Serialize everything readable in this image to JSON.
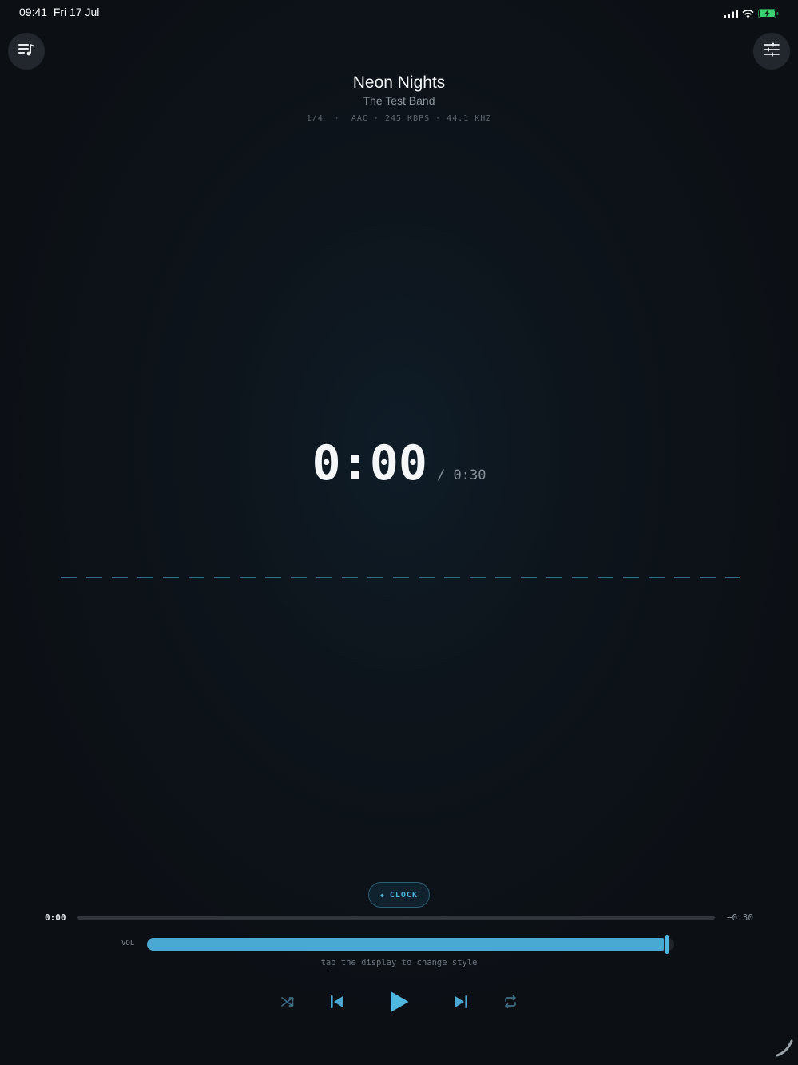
{
  "status_bar": {
    "time_date": "09:41  Fri 17 Jul",
    "icons": [
      "cellular-signal-icon",
      "wifi-icon",
      "battery-charging-icon"
    ],
    "battery_color": "#3bd16f"
  },
  "header": {
    "left_button_icon": "playlist-icon",
    "right_button_icon": "equalizer-sliders-icon"
  },
  "track": {
    "title": "Neon Nights",
    "artist": "The Test Band",
    "meta": "1/4  ·  AAC · 245 KBPS · 44.1 KHZ"
  },
  "display": {
    "current_time": "0:00",
    "total_time": "/ 0:30"
  },
  "style_chip": {
    "dot": "◆",
    "label": "CLOCK"
  },
  "playback": {
    "elapsed": "0:00",
    "remaining": "−0:30",
    "progress_fraction": 0.0
  },
  "volume": {
    "label": "VOL",
    "level_fraction": 0.99
  },
  "hint": "tap the display to change style",
  "controls": {
    "shuffle_icon": "shuffle-icon",
    "previous_icon": "skip-previous-icon",
    "play_icon": "play-icon",
    "next_icon": "skip-next-icon",
    "repeat_icon": "repeat-icon"
  },
  "colors": {
    "accent": "#4aa9d2",
    "accent_bright": "#4fb8e2",
    "background": "#0d1116",
    "muted_text": "#8a939b"
  }
}
